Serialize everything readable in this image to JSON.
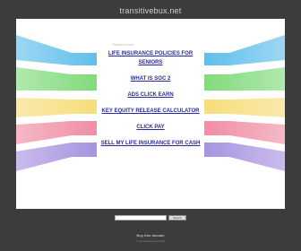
{
  "header": {
    "domain": "transitivebux.net"
  },
  "related": {
    "label": "Related Links"
  },
  "links": [
    {
      "label": "LIFE INSURANCE POLICIES FOR SENIORS"
    },
    {
      "label": "WHAT IS SOC 2"
    },
    {
      "label": "ADS CLICK EARN"
    },
    {
      "label": "KEY EQUITY RELEASE CALCULATOR"
    },
    {
      "label": "CLICK PAY"
    },
    {
      "label": "SELL MY LIFE INSURANCE FOR CASH"
    }
  ],
  "search": {
    "placeholder": "",
    "button_label": "Search"
  },
  "footer": {
    "buy_label": "Buy this domain",
    "note": "© transitivebux.net 2024"
  },
  "colors": {
    "background": "#3c3c3c",
    "link": "#2a2aa6",
    "band_blue": "#4cb6e8",
    "band_green": "#71d66b",
    "band_yellow": "#f5d969",
    "band_pink": "#ee7f98",
    "band_purple": "#9c86dc"
  }
}
